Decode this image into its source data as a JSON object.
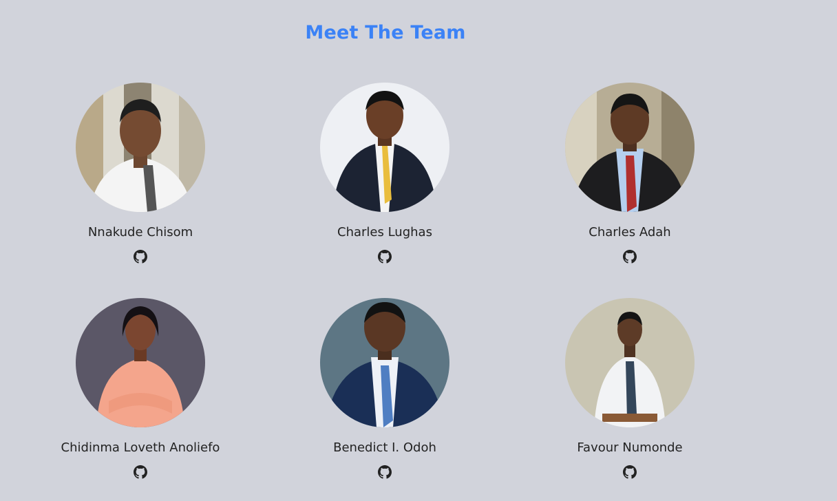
{
  "header": {
    "title": "Meet The Team"
  },
  "team": [
    {
      "name": "Nnakude Chisom",
      "link_icon": "github-icon"
    },
    {
      "name": "Charles Lughas",
      "link_icon": "github-icon"
    },
    {
      "name": "Charles Adah",
      "link_icon": "github-icon"
    },
    {
      "name": "Chidinma Loveth Anoliefo",
      "link_icon": "github-icon"
    },
    {
      "name": "Benedict I. Odoh",
      "link_icon": "github-icon"
    },
    {
      "name": "Favour Numonde",
      "link_icon": "github-icon"
    }
  ],
  "colors": {
    "background": "#d1d3db",
    "title": "#3b82f6",
    "text": "#222222"
  }
}
